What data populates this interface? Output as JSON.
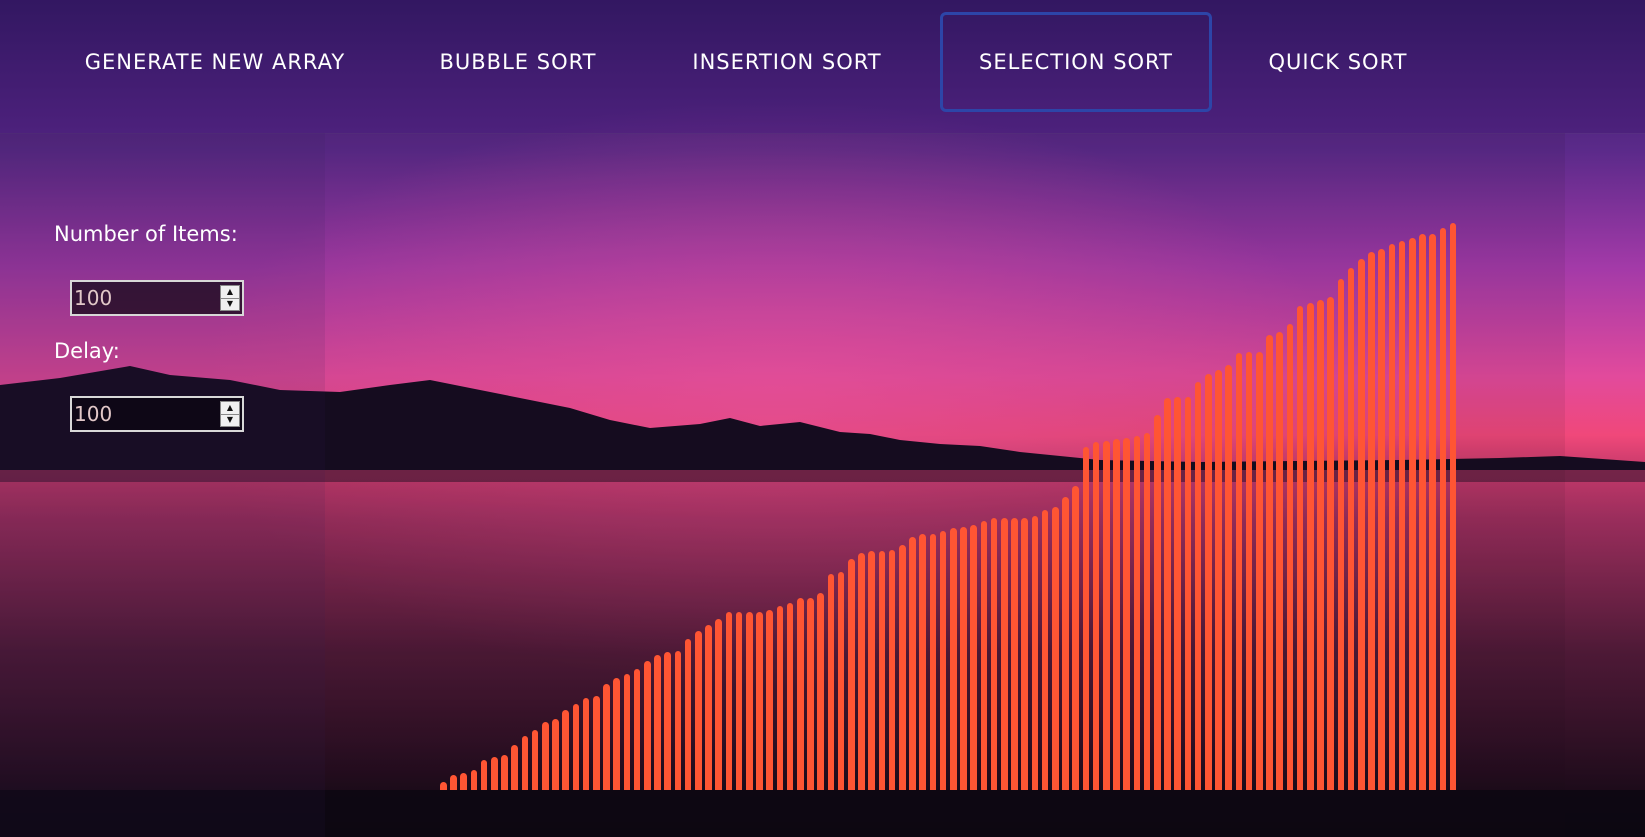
{
  "navbar": {
    "buttons": [
      {
        "label": "GENERATE NEW ARRAY",
        "active": false
      },
      {
        "label": "BUBBLE SORT",
        "active": false
      },
      {
        "label": "INSERTION SORT",
        "active": false
      },
      {
        "label": "SELECTION SORT",
        "active": true
      },
      {
        "label": "QUICK SORT",
        "active": false
      }
    ]
  },
  "controls": {
    "items_label": "Number of Items:",
    "items_value": "100",
    "delay_label": "Delay:",
    "delay_value": "100"
  },
  "colors": {
    "bar": "#ff5533",
    "active_border": "#2d45a8"
  },
  "chart_data": {
    "type": "bar",
    "values": [
      5,
      10,
      11,
      13,
      20,
      22,
      23,
      30,
      36,
      40,
      45,
      47,
      53,
      57,
      61,
      62,
      70,
      74,
      77,
      80,
      85,
      89,
      91,
      92,
      100,
      105,
      109,
      113,
      118,
      118,
      118,
      118,
      119,
      122,
      124,
      127,
      127,
      130,
      143,
      144,
      153,
      157,
      158,
      158,
      159,
      162,
      167,
      169,
      169,
      171,
      173,
      174,
      175,
      178,
      180,
      180,
      180,
      180,
      181,
      185,
      187,
      194,
      201,
      227,
      230,
      231,
      232,
      233,
      234,
      236,
      248,
      259,
      260,
      260,
      270,
      275,
      278,
      281,
      289,
      290,
      290,
      301,
      303,
      308,
      320,
      322,
      324,
      326,
      338,
      345,
      351,
      356,
      358,
      361,
      363,
      365,
      368,
      368,
      372,
      375
    ],
    "sorted": true
  }
}
